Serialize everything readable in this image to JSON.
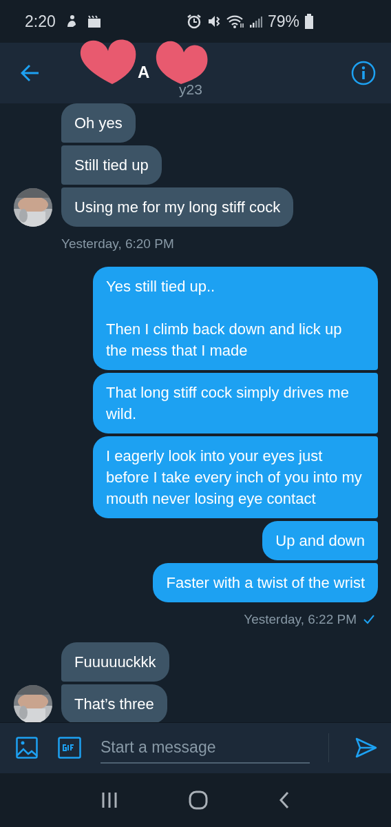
{
  "status_bar": {
    "time": "2:20",
    "battery": "79%"
  },
  "header": {
    "name": "A",
    "handle_parts": [
      "y23"
    ]
  },
  "conversation": [
    {
      "kind": "received",
      "messages": [
        "Oh yes",
        "Still tied up",
        "Using me for my long stiff cock"
      ],
      "timestamp": "Yesterday, 6:20 PM"
    },
    {
      "kind": "sent",
      "messages": [
        "Yes still tied up..\n\nThen I climb back down and lick up the mess that I made",
        "That long stiff cock simply drives me wild.",
        "I eagerly look into your eyes just before I take every inch of you into my mouth never losing eye contact",
        "Up and down",
        "Faster with a twist of the wrist"
      ],
      "timestamp": "Yesterday, 6:22 PM",
      "read": true
    },
    {
      "kind": "received",
      "messages": [
        "Fuuuuuckkk",
        "That’s three"
      ]
    }
  ],
  "composer": {
    "placeholder": "Start a message"
  }
}
